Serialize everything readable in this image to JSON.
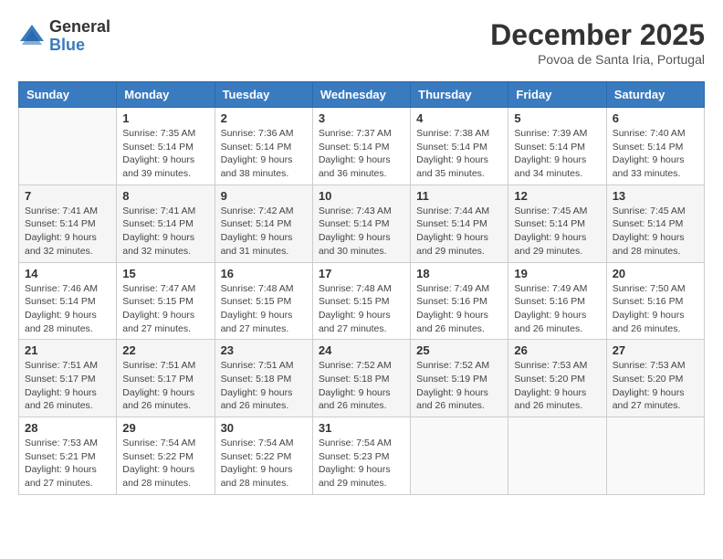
{
  "logo": {
    "general": "General",
    "blue": "Blue"
  },
  "title": "December 2025",
  "location": "Povoa de Santa Iria, Portugal",
  "weekdays": [
    "Sunday",
    "Monday",
    "Tuesday",
    "Wednesday",
    "Thursday",
    "Friday",
    "Saturday"
  ],
  "weeks": [
    [
      {
        "day": "",
        "sunrise": "",
        "sunset": "",
        "daylight": ""
      },
      {
        "day": "1",
        "sunrise": "Sunrise: 7:35 AM",
        "sunset": "Sunset: 5:14 PM",
        "daylight": "Daylight: 9 hours and 39 minutes."
      },
      {
        "day": "2",
        "sunrise": "Sunrise: 7:36 AM",
        "sunset": "Sunset: 5:14 PM",
        "daylight": "Daylight: 9 hours and 38 minutes."
      },
      {
        "day": "3",
        "sunrise": "Sunrise: 7:37 AM",
        "sunset": "Sunset: 5:14 PM",
        "daylight": "Daylight: 9 hours and 36 minutes."
      },
      {
        "day": "4",
        "sunrise": "Sunrise: 7:38 AM",
        "sunset": "Sunset: 5:14 PM",
        "daylight": "Daylight: 9 hours and 35 minutes."
      },
      {
        "day": "5",
        "sunrise": "Sunrise: 7:39 AM",
        "sunset": "Sunset: 5:14 PM",
        "daylight": "Daylight: 9 hours and 34 minutes."
      },
      {
        "day": "6",
        "sunrise": "Sunrise: 7:40 AM",
        "sunset": "Sunset: 5:14 PM",
        "daylight": "Daylight: 9 hours and 33 minutes."
      }
    ],
    [
      {
        "day": "7",
        "sunrise": "Sunrise: 7:41 AM",
        "sunset": "Sunset: 5:14 PM",
        "daylight": "Daylight: 9 hours and 32 minutes."
      },
      {
        "day": "8",
        "sunrise": "Sunrise: 7:41 AM",
        "sunset": "Sunset: 5:14 PM",
        "daylight": "Daylight: 9 hours and 32 minutes."
      },
      {
        "day": "9",
        "sunrise": "Sunrise: 7:42 AM",
        "sunset": "Sunset: 5:14 PM",
        "daylight": "Daylight: 9 hours and 31 minutes."
      },
      {
        "day": "10",
        "sunrise": "Sunrise: 7:43 AM",
        "sunset": "Sunset: 5:14 PM",
        "daylight": "Daylight: 9 hours and 30 minutes."
      },
      {
        "day": "11",
        "sunrise": "Sunrise: 7:44 AM",
        "sunset": "Sunset: 5:14 PM",
        "daylight": "Daylight: 9 hours and 29 minutes."
      },
      {
        "day": "12",
        "sunrise": "Sunrise: 7:45 AM",
        "sunset": "Sunset: 5:14 PM",
        "daylight": "Daylight: 9 hours and 29 minutes."
      },
      {
        "day": "13",
        "sunrise": "Sunrise: 7:45 AM",
        "sunset": "Sunset: 5:14 PM",
        "daylight": "Daylight: 9 hours and 28 minutes."
      }
    ],
    [
      {
        "day": "14",
        "sunrise": "Sunrise: 7:46 AM",
        "sunset": "Sunset: 5:14 PM",
        "daylight": "Daylight: 9 hours and 28 minutes."
      },
      {
        "day": "15",
        "sunrise": "Sunrise: 7:47 AM",
        "sunset": "Sunset: 5:15 PM",
        "daylight": "Daylight: 9 hours and 27 minutes."
      },
      {
        "day": "16",
        "sunrise": "Sunrise: 7:48 AM",
        "sunset": "Sunset: 5:15 PM",
        "daylight": "Daylight: 9 hours and 27 minutes."
      },
      {
        "day": "17",
        "sunrise": "Sunrise: 7:48 AM",
        "sunset": "Sunset: 5:15 PM",
        "daylight": "Daylight: 9 hours and 27 minutes."
      },
      {
        "day": "18",
        "sunrise": "Sunrise: 7:49 AM",
        "sunset": "Sunset: 5:16 PM",
        "daylight": "Daylight: 9 hours and 26 minutes."
      },
      {
        "day": "19",
        "sunrise": "Sunrise: 7:49 AM",
        "sunset": "Sunset: 5:16 PM",
        "daylight": "Daylight: 9 hours and 26 minutes."
      },
      {
        "day": "20",
        "sunrise": "Sunrise: 7:50 AM",
        "sunset": "Sunset: 5:16 PM",
        "daylight": "Daylight: 9 hours and 26 minutes."
      }
    ],
    [
      {
        "day": "21",
        "sunrise": "Sunrise: 7:51 AM",
        "sunset": "Sunset: 5:17 PM",
        "daylight": "Daylight: 9 hours and 26 minutes."
      },
      {
        "day": "22",
        "sunrise": "Sunrise: 7:51 AM",
        "sunset": "Sunset: 5:17 PM",
        "daylight": "Daylight: 9 hours and 26 minutes."
      },
      {
        "day": "23",
        "sunrise": "Sunrise: 7:51 AM",
        "sunset": "Sunset: 5:18 PM",
        "daylight": "Daylight: 9 hours and 26 minutes."
      },
      {
        "day": "24",
        "sunrise": "Sunrise: 7:52 AM",
        "sunset": "Sunset: 5:18 PM",
        "daylight": "Daylight: 9 hours and 26 minutes."
      },
      {
        "day": "25",
        "sunrise": "Sunrise: 7:52 AM",
        "sunset": "Sunset: 5:19 PM",
        "daylight": "Daylight: 9 hours and 26 minutes."
      },
      {
        "day": "26",
        "sunrise": "Sunrise: 7:53 AM",
        "sunset": "Sunset: 5:20 PM",
        "daylight": "Daylight: 9 hours and 26 minutes."
      },
      {
        "day": "27",
        "sunrise": "Sunrise: 7:53 AM",
        "sunset": "Sunset: 5:20 PM",
        "daylight": "Daylight: 9 hours and 27 minutes."
      }
    ],
    [
      {
        "day": "28",
        "sunrise": "Sunrise: 7:53 AM",
        "sunset": "Sunset: 5:21 PM",
        "daylight": "Daylight: 9 hours and 27 minutes."
      },
      {
        "day": "29",
        "sunrise": "Sunrise: 7:54 AM",
        "sunset": "Sunset: 5:22 PM",
        "daylight": "Daylight: 9 hours and 28 minutes."
      },
      {
        "day": "30",
        "sunrise": "Sunrise: 7:54 AM",
        "sunset": "Sunset: 5:22 PM",
        "daylight": "Daylight: 9 hours and 28 minutes."
      },
      {
        "day": "31",
        "sunrise": "Sunrise: 7:54 AM",
        "sunset": "Sunset: 5:23 PM",
        "daylight": "Daylight: 9 hours and 29 minutes."
      },
      {
        "day": "",
        "sunrise": "",
        "sunset": "",
        "daylight": ""
      },
      {
        "day": "",
        "sunrise": "",
        "sunset": "",
        "daylight": ""
      },
      {
        "day": "",
        "sunrise": "",
        "sunset": "",
        "daylight": ""
      }
    ]
  ]
}
